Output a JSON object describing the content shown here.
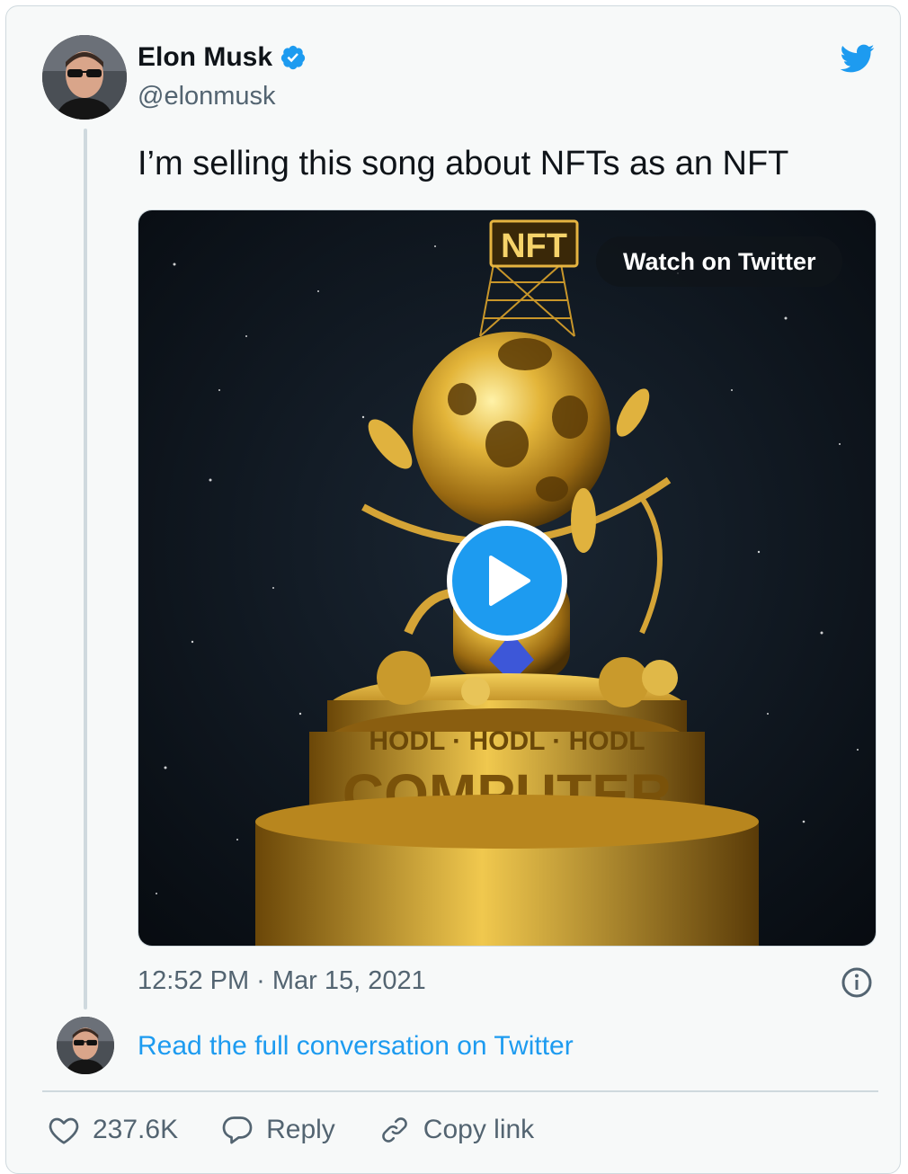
{
  "author": {
    "name": "Elon Musk",
    "handle": "@elonmusk",
    "verified": true
  },
  "tweet": {
    "text": "I’m selling this song about NFTs as an NFT",
    "timestamp": "12:52 PM · Mar 15, 2021"
  },
  "media": {
    "watch_label": "Watch on Twitter",
    "sign_text": "NFT",
    "ring_text": "HODL · HODL · HODL",
    "base_text": "COMPUTER"
  },
  "conversation": {
    "link_label": "Read the full conversation on Twitter"
  },
  "actions": {
    "likes": "237.6K",
    "reply_label": "Reply",
    "copy_label": "Copy link"
  },
  "colors": {
    "accent": "#1d9bf0",
    "text": "#0f1419",
    "muted": "#536471",
    "border": "#cfd9de",
    "card_bg": "#f7f9f9"
  },
  "icons": [
    "twitter-bird-icon",
    "verified-badge-icon",
    "play-icon",
    "info-icon",
    "heart-icon",
    "reply-icon",
    "link-icon"
  ]
}
